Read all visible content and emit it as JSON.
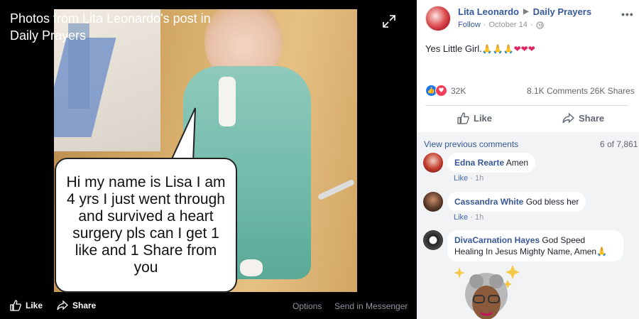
{
  "viewer": {
    "title": "Photos from Lita Leonardo's post in Daily Prayers",
    "bubble_text": "Hi my name is Lisa I am 4 yrs I just went through and survived a heart surgery pls can I get 1 like and 1 Share from you",
    "like_label": "Like",
    "share_label": "Share",
    "options_label": "Options",
    "messenger_label": "Send in Messenger"
  },
  "post": {
    "author": "Lita Leonardo",
    "group": "Daily Prayers",
    "follow_label": "Follow",
    "date": "October 14",
    "separator": "·",
    "text": "Yes Little Girl.",
    "emoji_tail": [
      "🙏",
      "🙏",
      "🙏",
      "❤",
      "❤",
      "❤"
    ],
    "reactions_count": "32K",
    "comments_count": "8.1K Comments",
    "shares_count": "26K Shares",
    "like_label": "Like",
    "share_label": "Share"
  },
  "comments": {
    "view_previous": "View previous comments",
    "page_count": "6 of 7,861",
    "items": [
      {
        "name": "Edna Rearte",
        "text": "Amen",
        "like": "Like",
        "time": "1h"
      },
      {
        "name": "Cassandra White",
        "text": "God bless her",
        "like": "Like",
        "time": "1h"
      },
      {
        "name": "DivaCarnation Hayes",
        "text": "God Speed Healing In Jesus Mighty Name, Amen🙏"
      }
    ]
  },
  "colors": {
    "link": "#365899",
    "like_blue": "#1877f2",
    "love_red": "#f33e58",
    "viewer_bg": "#000000"
  }
}
